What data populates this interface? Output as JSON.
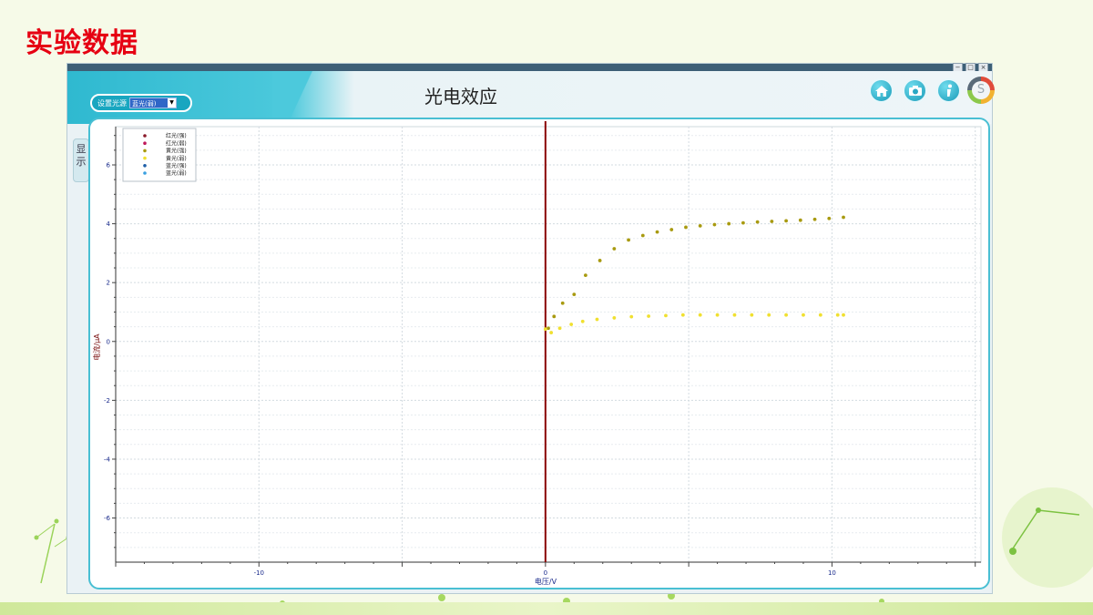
{
  "slide": {
    "title": "实验数据"
  },
  "window": {
    "title": "光电效应",
    "controls": {
      "minimize": "−",
      "maximize": "□",
      "close": "×"
    }
  },
  "light_source": {
    "label": "设置光源",
    "selected": "蓝光(弱)"
  },
  "toolbar": {
    "icons": [
      "home-icon",
      "camera-icon",
      "info-icon",
      "settings-spinner-icon"
    ]
  },
  "side_tab": {
    "label": "显示"
  },
  "colors": {
    "title_red": "#e60012",
    "header_teal": "#2fb9d0",
    "frame_teal": "#49bfd3",
    "axis_red": "#8b0000",
    "axis_label_blue": "#1a2b8c"
  },
  "chart_data": {
    "type": "scatter",
    "xlabel": "电压/V",
    "ylabel": "电流/μA",
    "xlim": [
      -15,
      15.2
    ],
    "ylim": [
      -7.5,
      7.3
    ],
    "x_ticks": [
      -10,
      0,
      10
    ],
    "x_tick_labels": [
      "-10",
      "0",
      "10"
    ],
    "y_ticks": [
      -6,
      -4,
      -2,
      0,
      2,
      4,
      6
    ],
    "y_tick_labels": [
      "-6",
      "-4",
      "-2",
      "0",
      "2",
      "4",
      "6"
    ],
    "grid": true,
    "legend_position": "top-left",
    "legend": [
      {
        "name": "红光(强)",
        "color": "#8b1a2a"
      },
      {
        "name": "红光(弱)",
        "color": "#c0185a"
      },
      {
        "name": "黄光(强)",
        "color": "#a89a10"
      },
      {
        "name": "黄光(弱)",
        "color": "#f0e030"
      },
      {
        "name": "蓝光(强)",
        "color": "#1f5fa8"
      },
      {
        "name": "蓝光(弱)",
        "color": "#3aa0e0"
      }
    ],
    "series": [
      {
        "name": "黄光(强)",
        "color": "#a89a10",
        "points": [
          [
            0.1,
            0.45
          ],
          [
            0.3,
            0.85
          ],
          [
            0.6,
            1.3
          ],
          [
            1.0,
            1.6
          ],
          [
            1.4,
            2.25
          ],
          [
            1.9,
            2.75
          ],
          [
            2.4,
            3.15
          ],
          [
            2.9,
            3.45
          ],
          [
            3.4,
            3.6
          ],
          [
            3.9,
            3.72
          ],
          [
            4.4,
            3.8
          ],
          [
            4.9,
            3.88
          ],
          [
            5.4,
            3.93
          ],
          [
            5.9,
            3.97
          ],
          [
            6.4,
            4.0
          ],
          [
            6.9,
            4.03
          ],
          [
            7.4,
            4.06
          ],
          [
            7.9,
            4.08
          ],
          [
            8.4,
            4.1
          ],
          [
            8.9,
            4.12
          ],
          [
            9.4,
            4.15
          ],
          [
            9.9,
            4.18
          ],
          [
            10.4,
            4.22
          ]
        ]
      },
      {
        "name": "黄光(弱)",
        "color": "#f0e030",
        "points": [
          [
            0.0,
            0.42
          ],
          [
            0.2,
            0.3
          ],
          [
            0.5,
            0.45
          ],
          [
            0.9,
            0.58
          ],
          [
            1.3,
            0.68
          ],
          [
            1.8,
            0.75
          ],
          [
            2.4,
            0.8
          ],
          [
            3.0,
            0.84
          ],
          [
            3.6,
            0.86
          ],
          [
            4.2,
            0.88
          ],
          [
            4.8,
            0.9
          ],
          [
            5.4,
            0.9
          ],
          [
            6.0,
            0.9
          ],
          [
            6.6,
            0.9
          ],
          [
            7.2,
            0.9
          ],
          [
            7.8,
            0.9
          ],
          [
            8.4,
            0.9
          ],
          [
            9.0,
            0.9
          ],
          [
            9.6,
            0.9
          ],
          [
            10.2,
            0.9
          ],
          [
            10.4,
            0.9
          ]
        ]
      }
    ]
  }
}
